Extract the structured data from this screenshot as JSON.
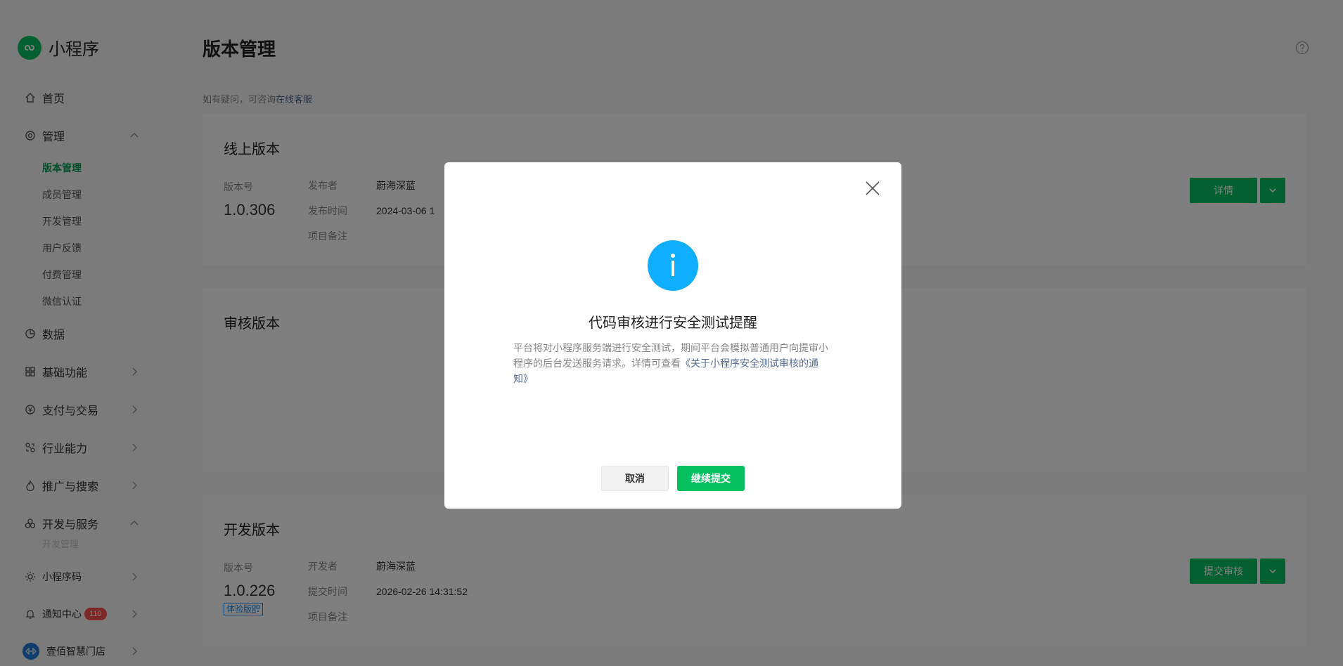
{
  "app": {
    "title": "小程序"
  },
  "sidebar": {
    "home": "首页",
    "manage": "管理",
    "manage_items": [
      "版本管理",
      "成员管理",
      "开发管理",
      "用户反馈",
      "付费管理",
      "微信认证"
    ],
    "data": "数据",
    "basic": "基础功能",
    "pay": "支付与交易",
    "industry": "行业能力",
    "promote": "推广与搜索",
    "devservice": "开发与服务",
    "devservice_faded": "开发管理",
    "qrcode": "小程序码",
    "notify": "通知中心",
    "notify_badge": "110",
    "account": "壹佰智慧门店"
  },
  "page": {
    "title": "版本管理",
    "hint_prefix": "如有疑问，可咨询",
    "hint_link": "在线客服"
  },
  "online": {
    "title": "线上版本",
    "ver_label": "版本号",
    "version": "1.0.306",
    "publisher_k": "发布者",
    "publisher_v": "蔚海深蓝",
    "time_k": "发布时间",
    "time_v": "2024-03-06 1",
    "note_k": "项目备注",
    "btn": "详情"
  },
  "review": {
    "title": "审核版本"
  },
  "dev": {
    "title": "开发版本",
    "ver_label": "版本号",
    "version": "1.0.226",
    "tag": "体验版",
    "dev_k": "开发者",
    "dev_v": "蔚海深蓝",
    "time_k": "提交时间",
    "time_v": "2026-02-26 14:31:52",
    "note_k": "项目备注",
    "btn": "提交审核"
  },
  "dialog": {
    "title": "代码审核进行安全测试提醒",
    "desc": "平台将对小程序服务端进行安全测试，期间平台会模拟普通用户向提审小程序的后台发送服务请求。详情可查看",
    "link": "《关于小程序安全测试审核的通知》",
    "cancel": "取消",
    "confirm": "继续提交"
  },
  "colors": {
    "brand_green": "#07c160",
    "info_blue": "#10aeff",
    "link": "#576b95",
    "badge_red": "#fa5151"
  }
}
